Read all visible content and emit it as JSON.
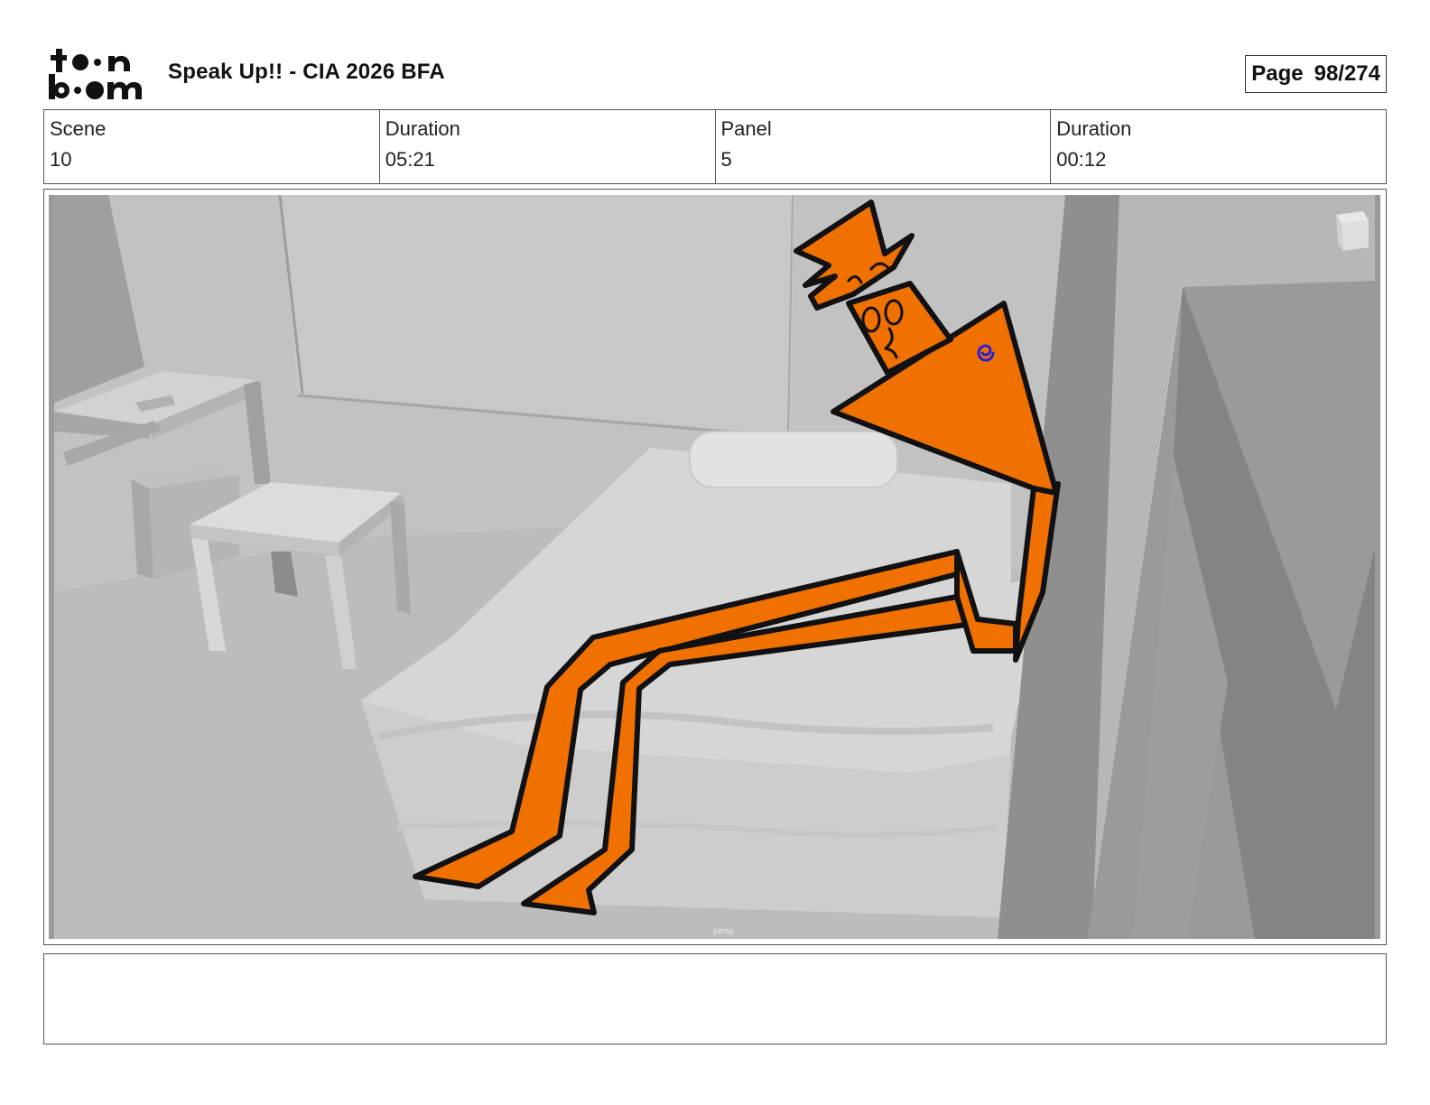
{
  "header": {
    "logo_text_top": "toon",
    "logo_text_bottom": "boom",
    "project_title": "Speak Up!! - CIA 2026 BFA",
    "page_label": "Page",
    "page_value": "98/274"
  },
  "info": {
    "scene_label": "Scene",
    "scene_value": "10",
    "scene_duration_label": "Duration",
    "scene_duration_value": "05:21",
    "panel_label": "Panel",
    "panel_value": "5",
    "panel_duration_label": "Duration",
    "panel_duration_value": "00:12"
  },
  "panel": {
    "viewport_label": "persp",
    "character_color": "#f07000",
    "outline_color": "#111111",
    "swirl_color": "#2a1fd0"
  },
  "notes": {
    "text": ""
  }
}
